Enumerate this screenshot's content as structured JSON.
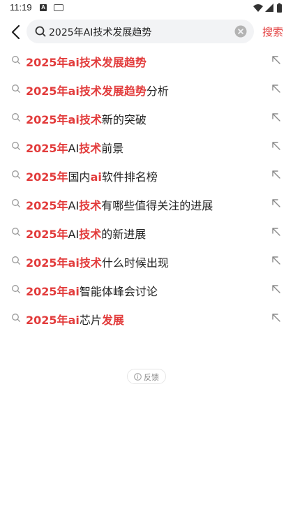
{
  "status_bar": {
    "time": "11:19",
    "notification_badge": "A"
  },
  "search": {
    "query": "2025年AI技术发展趋势",
    "submit_label": "搜索"
  },
  "suggestions": [
    {
      "parts": [
        {
          "t": "2025年ai技术发展趋势",
          "hl": true
        }
      ]
    },
    {
      "parts": [
        {
          "t": "2025年ai技术发展趋势",
          "hl": true
        },
        {
          "t": "分析",
          "hl": false
        }
      ]
    },
    {
      "parts": [
        {
          "t": "2025年ai技术",
          "hl": true
        },
        {
          "t": "新的突破",
          "hl": false
        }
      ]
    },
    {
      "parts": [
        {
          "t": "2025年",
          "hl": true
        },
        {
          "t": "AI",
          "hl": false
        },
        {
          "t": "技术",
          "hl": true
        },
        {
          "t": "前景",
          "hl": false
        }
      ]
    },
    {
      "parts": [
        {
          "t": "2025年",
          "hl": true
        },
        {
          "t": "国内",
          "hl": false
        },
        {
          "t": "ai",
          "hl": true
        },
        {
          "t": "软件排名榜",
          "hl": false
        }
      ]
    },
    {
      "parts": [
        {
          "t": "2025年",
          "hl": true
        },
        {
          "t": "AI",
          "hl": false
        },
        {
          "t": "技术",
          "hl": true
        },
        {
          "t": "有哪些值得关注的进展",
          "hl": false
        }
      ]
    },
    {
      "parts": [
        {
          "t": "2025年",
          "hl": true
        },
        {
          "t": "AI",
          "hl": false
        },
        {
          "t": "技术",
          "hl": true
        },
        {
          "t": "的新进展",
          "hl": false
        }
      ]
    },
    {
      "parts": [
        {
          "t": "2025年ai技术",
          "hl": true
        },
        {
          "t": "什么时候出现",
          "hl": false
        }
      ]
    },
    {
      "parts": [
        {
          "t": "2025年ai",
          "hl": true
        },
        {
          "t": "智能体峰会讨论",
          "hl": false
        }
      ]
    },
    {
      "parts": [
        {
          "t": "2025年ai",
          "hl": true
        },
        {
          "t": "芯片",
          "hl": false
        },
        {
          "t": "发展",
          "hl": true
        }
      ]
    }
  ],
  "feedback": {
    "label": "反馈"
  },
  "colors": {
    "accent": "#e23b3b",
    "search_bg": "#f2f3f5",
    "text": "#222222",
    "icon_grey": "#888888"
  },
  "icons": {
    "back": "chevron-left-icon",
    "search": "search-icon",
    "clear": "clear-icon",
    "suggestion": "search-icon",
    "fill_query": "arrow-up-left-icon",
    "feedback": "info-icon"
  }
}
